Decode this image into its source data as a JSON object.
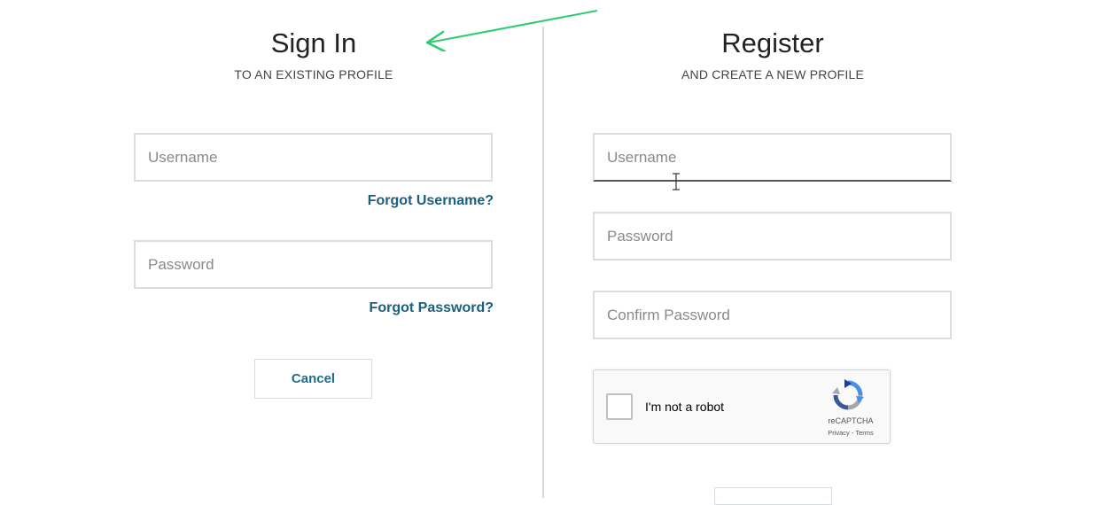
{
  "signin": {
    "title": "Sign In",
    "subtitle": "TO AN EXISTING PROFILE",
    "username_placeholder": "Username",
    "forgot_username": "Forgot Username?",
    "password_placeholder": "Password",
    "forgot_password": "Forgot Password?",
    "cancel_label": "Cancel"
  },
  "register": {
    "title": "Register",
    "subtitle": "AND CREATE A NEW PROFILE",
    "username_placeholder": "Username",
    "password_placeholder": "Password",
    "confirm_password_placeholder": "Confirm Password",
    "captcha": {
      "label": "I'm not a robot",
      "brand": "reCAPTCHA",
      "terms": "Privacy - Terms"
    }
  },
  "colors": {
    "link": "#1b5e7e",
    "annotation_arrow": "#2ecc71"
  },
  "icons": {
    "annotation": "green-arrow-icon",
    "captcha": "recaptcha-logo-icon",
    "cursor": "text-cursor-icon"
  }
}
